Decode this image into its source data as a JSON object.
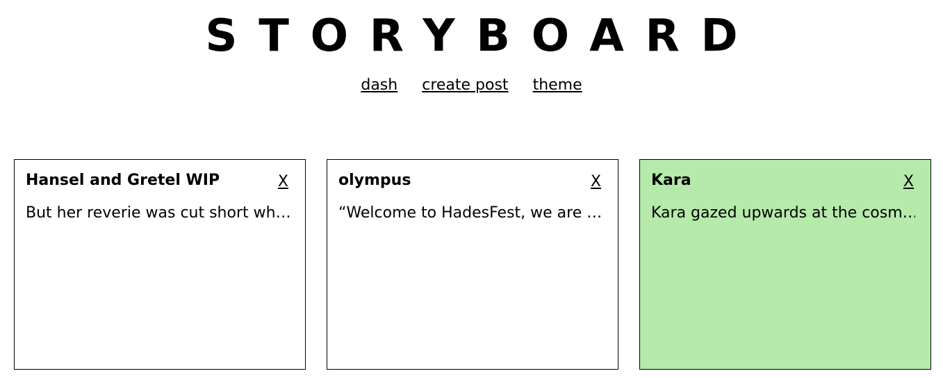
{
  "header": {
    "title": "STORYBOARD",
    "nav": [
      {
        "label": "dash"
      },
      {
        "label": "create post"
      },
      {
        "label": "theme"
      }
    ]
  },
  "cards": [
    {
      "title": "Hansel and Gretel WIP",
      "close_label": "X",
      "excerpt": "But her reverie was cut short wh…",
      "background": "#ffffff"
    },
    {
      "title": "olympus",
      "close_label": "X",
      "excerpt": "“Welcome to HadesFest, we are …",
      "background": "#ffffff"
    },
    {
      "title": "Kara",
      "close_label": "X",
      "excerpt": "Kara gazed upwards at the cosm…",
      "background": "#b6eaab"
    }
  ]
}
